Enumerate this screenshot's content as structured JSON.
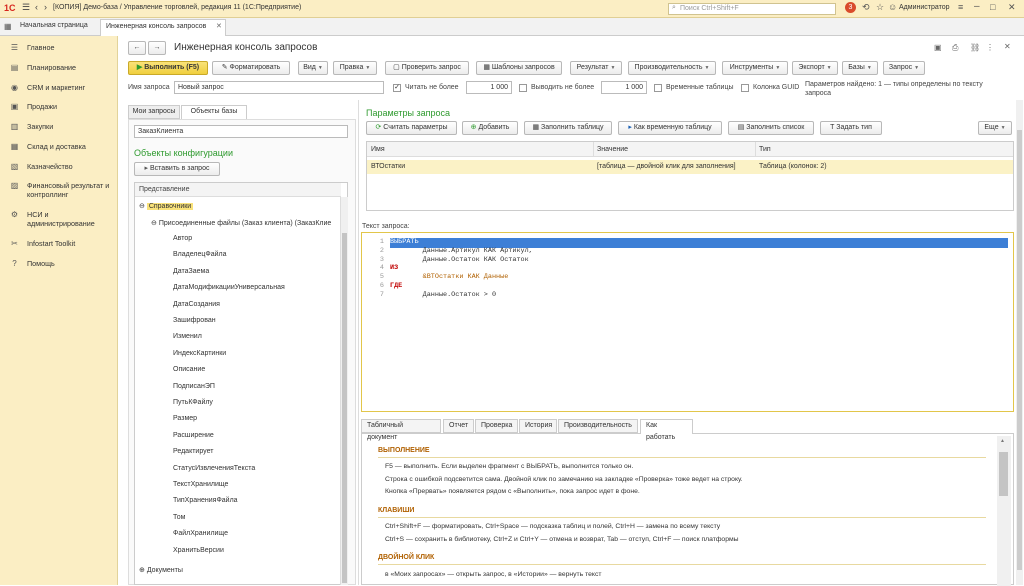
{
  "titlebar": {
    "app_icon": "1C",
    "title": "[КОПИЯ] Демо-база / Управление торговлей, редакция 11 (1С:Предприятие)",
    "search_placeholder": "Поиск Ctrl+Shift+F",
    "notify_count": "3",
    "user": "Администратор"
  },
  "tabs": {
    "home": "Начальная страница",
    "active": "Инженерная консоль запросов"
  },
  "sidebar": {
    "items": [
      {
        "label": "Главное",
        "icon": "menu-icon"
      },
      {
        "label": "Планирование",
        "icon": "chart-icon"
      },
      {
        "label": "CRM и маркетинг",
        "icon": "crm-icon"
      },
      {
        "label": "Продажи",
        "icon": "cart-icon"
      },
      {
        "label": "Закупки",
        "icon": "truck-icon"
      },
      {
        "label": "Склад и доставка",
        "icon": "warehouse-icon"
      },
      {
        "label": "Казначейство",
        "icon": "money-icon"
      },
      {
        "label": "Финансовый результат и контроллинг",
        "icon": "finance-icon"
      },
      {
        "label": "НСИ и администрирование",
        "icon": "gear-icon"
      },
      {
        "label": "Infostart Toolkit",
        "icon": "tools-icon"
      },
      {
        "label": "Помощь",
        "icon": "help-icon"
      }
    ]
  },
  "page": {
    "title": "Инженерная консоль запросов"
  },
  "toolbar": {
    "run": "Выполнить (F5)",
    "format": "Форматировать",
    "vid": "Вид",
    "edit": "Правка",
    "check": "Проверить запрос",
    "templates": "Шаблоны запросов",
    "result": "Результат",
    "perf": "Производительность",
    "tools": "Инструменты",
    "export": "Экспорт",
    "bases": "Базы",
    "query": "Запрос"
  },
  "options": {
    "name_label": "Имя запроса",
    "name_value": "Новый запрос",
    "read_limit_label": "Читать не более",
    "read_limit_value": "1 000",
    "out_limit_label": "Выводить не более",
    "out_limit_value": "1 000",
    "temp_tables": "Временные таблицы",
    "guid_col": "Колонка GUID",
    "params_found": "Параметров найдено: 1 — типы определены по тексту запроса"
  },
  "left": {
    "tab_my": "Мои запросы",
    "tab_objects": "Объекты базы",
    "filter_value": "ЗаказКлиента",
    "config_title": "Объекты конфигурации",
    "insert_btn": "Вставить в запрос",
    "tree_header": "Представление",
    "tree": {
      "catalogs": "Справочники",
      "attached": "Присоединенные файлы (Заказ клиента) (ЗаказКлие",
      "fields": [
        "Автор",
        "ВладелецФайла",
        "ДатаЗаема",
        "ДатаМодификацииУниверсальная",
        "ДатаСоздания",
        "Зашифрован",
        "Изменил",
        "ИндексКартинки",
        "Описание",
        "ПодписанЭП",
        "ПутьКФайлу",
        "Размер",
        "Расширение",
        "Редактирует",
        "СтатусИзвлеченияТекста",
        "ТекстХранилище",
        "ТипХраненияФайла",
        "Том",
        "ФайлХранилище",
        "ХранитьВерсии"
      ],
      "documents": "Документы"
    }
  },
  "params": {
    "title": "Параметры запроса",
    "btn_read": "Считать параметры",
    "btn_add": "Добавить",
    "btn_fill": "Заполнить таблицу",
    "btn_temp": "Как временную таблицу",
    "btn_list": "Заполнить список",
    "btn_type": "Задать тип",
    "btn_more": "Еще",
    "col_name": "Имя",
    "col_value": "Значение",
    "col_type": "Тип",
    "row": {
      "name": "ВТОстатки",
      "value": "[таблица — двойной клик для заполнения]",
      "type": "Таблица (колонок: 2)"
    }
  },
  "query": {
    "label": "Текст запроса:",
    "lines": [
      {
        "n": "1",
        "t": "ВЫБРАТЬ"
      },
      {
        "n": "2",
        "t": "        Данные.Артикул КАК Артикул,"
      },
      {
        "n": "3",
        "t": "        Данные.Остаток КАК Остаток"
      },
      {
        "n": "4",
        "t": "ИЗ"
      },
      {
        "n": "5",
        "t": "        &ВТОстатки КАК Данные"
      },
      {
        "n": "6",
        "t": "ГДЕ"
      },
      {
        "n": "7",
        "t": "        Данные.Остаток > 0"
      }
    ]
  },
  "bottom_tabs": [
    "Табличный документ",
    "Отчет",
    "Проверка",
    "История",
    "Производительность",
    "Как работать"
  ],
  "help": {
    "h1": "ВЫПОЛНЕНИЕ",
    "l1": "F5 — выполнить. Если выделен фрагмент с ВЫБРАТЬ, выполнится только он.",
    "l2": "Строка с ошибкой подсветится сама. Двойной клик по замечанию на закладке «Проверка» тоже ведет на строку.",
    "l3": "Кнопка «Прервать» появляется рядом с «Выполнить», пока запрос идет в фоне.",
    "h2": "КЛАВИШИ",
    "l4": "Ctrl+Shift+F — форматировать, Ctrl+Space — подсказка таблиц и полей, Ctrl+H — замена по всему тексту",
    "l5": "Ctrl+S — сохранить в библиотеку, Ctrl+Z и Ctrl+Y — отмена и возврат, Tab — отступ, Ctrl+F — поиск платформы",
    "h3": "ДВОЙНОЙ КЛИК",
    "l6": "в «Моих запросах» — открыть запрос, в «Истории» — вернуть текст"
  },
  "colors": {
    "accent_yellow": "#f5d44a",
    "run_green": "#e8f0b0",
    "brand_red": "#d7261e",
    "link_green": "#2e9a2e",
    "selection_blue": "#3d7fd6"
  }
}
